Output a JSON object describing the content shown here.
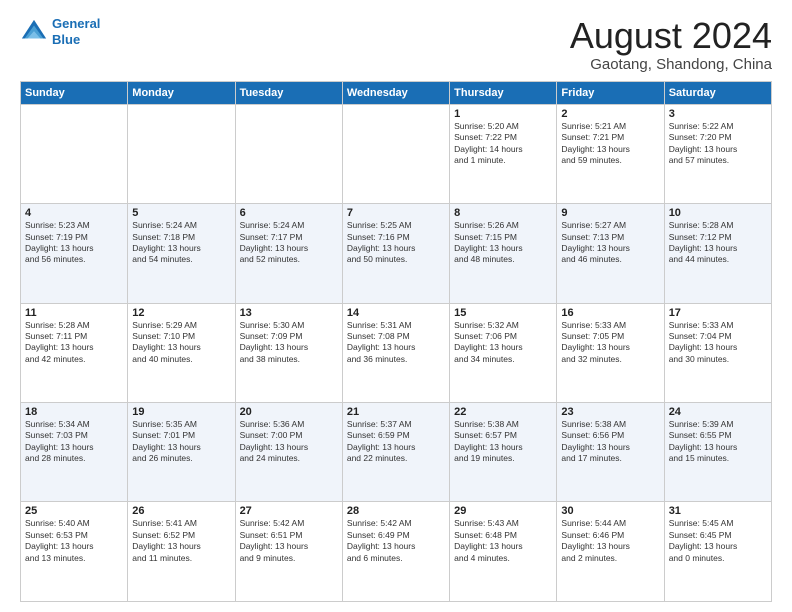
{
  "logo": {
    "line1": "General",
    "line2": "Blue"
  },
  "title": "August 2024",
  "location": "Gaotang, Shandong, China",
  "days_header": [
    "Sunday",
    "Monday",
    "Tuesday",
    "Wednesday",
    "Thursday",
    "Friday",
    "Saturday"
  ],
  "weeks": [
    [
      {
        "num": "",
        "info": ""
      },
      {
        "num": "",
        "info": ""
      },
      {
        "num": "",
        "info": ""
      },
      {
        "num": "",
        "info": ""
      },
      {
        "num": "1",
        "info": "Sunrise: 5:20 AM\nSunset: 7:22 PM\nDaylight: 14 hours\nand 1 minute."
      },
      {
        "num": "2",
        "info": "Sunrise: 5:21 AM\nSunset: 7:21 PM\nDaylight: 13 hours\nand 59 minutes."
      },
      {
        "num": "3",
        "info": "Sunrise: 5:22 AM\nSunset: 7:20 PM\nDaylight: 13 hours\nand 57 minutes."
      }
    ],
    [
      {
        "num": "4",
        "info": "Sunrise: 5:23 AM\nSunset: 7:19 PM\nDaylight: 13 hours\nand 56 minutes."
      },
      {
        "num": "5",
        "info": "Sunrise: 5:24 AM\nSunset: 7:18 PM\nDaylight: 13 hours\nand 54 minutes."
      },
      {
        "num": "6",
        "info": "Sunrise: 5:24 AM\nSunset: 7:17 PM\nDaylight: 13 hours\nand 52 minutes."
      },
      {
        "num": "7",
        "info": "Sunrise: 5:25 AM\nSunset: 7:16 PM\nDaylight: 13 hours\nand 50 minutes."
      },
      {
        "num": "8",
        "info": "Sunrise: 5:26 AM\nSunset: 7:15 PM\nDaylight: 13 hours\nand 48 minutes."
      },
      {
        "num": "9",
        "info": "Sunrise: 5:27 AM\nSunset: 7:13 PM\nDaylight: 13 hours\nand 46 minutes."
      },
      {
        "num": "10",
        "info": "Sunrise: 5:28 AM\nSunset: 7:12 PM\nDaylight: 13 hours\nand 44 minutes."
      }
    ],
    [
      {
        "num": "11",
        "info": "Sunrise: 5:28 AM\nSunset: 7:11 PM\nDaylight: 13 hours\nand 42 minutes."
      },
      {
        "num": "12",
        "info": "Sunrise: 5:29 AM\nSunset: 7:10 PM\nDaylight: 13 hours\nand 40 minutes."
      },
      {
        "num": "13",
        "info": "Sunrise: 5:30 AM\nSunset: 7:09 PM\nDaylight: 13 hours\nand 38 minutes."
      },
      {
        "num": "14",
        "info": "Sunrise: 5:31 AM\nSunset: 7:08 PM\nDaylight: 13 hours\nand 36 minutes."
      },
      {
        "num": "15",
        "info": "Sunrise: 5:32 AM\nSunset: 7:06 PM\nDaylight: 13 hours\nand 34 minutes."
      },
      {
        "num": "16",
        "info": "Sunrise: 5:33 AM\nSunset: 7:05 PM\nDaylight: 13 hours\nand 32 minutes."
      },
      {
        "num": "17",
        "info": "Sunrise: 5:33 AM\nSunset: 7:04 PM\nDaylight: 13 hours\nand 30 minutes."
      }
    ],
    [
      {
        "num": "18",
        "info": "Sunrise: 5:34 AM\nSunset: 7:03 PM\nDaylight: 13 hours\nand 28 minutes."
      },
      {
        "num": "19",
        "info": "Sunrise: 5:35 AM\nSunset: 7:01 PM\nDaylight: 13 hours\nand 26 minutes."
      },
      {
        "num": "20",
        "info": "Sunrise: 5:36 AM\nSunset: 7:00 PM\nDaylight: 13 hours\nand 24 minutes."
      },
      {
        "num": "21",
        "info": "Sunrise: 5:37 AM\nSunset: 6:59 PM\nDaylight: 13 hours\nand 22 minutes."
      },
      {
        "num": "22",
        "info": "Sunrise: 5:38 AM\nSunset: 6:57 PM\nDaylight: 13 hours\nand 19 minutes."
      },
      {
        "num": "23",
        "info": "Sunrise: 5:38 AM\nSunset: 6:56 PM\nDaylight: 13 hours\nand 17 minutes."
      },
      {
        "num": "24",
        "info": "Sunrise: 5:39 AM\nSunset: 6:55 PM\nDaylight: 13 hours\nand 15 minutes."
      }
    ],
    [
      {
        "num": "25",
        "info": "Sunrise: 5:40 AM\nSunset: 6:53 PM\nDaylight: 13 hours\nand 13 minutes."
      },
      {
        "num": "26",
        "info": "Sunrise: 5:41 AM\nSunset: 6:52 PM\nDaylight: 13 hours\nand 11 minutes."
      },
      {
        "num": "27",
        "info": "Sunrise: 5:42 AM\nSunset: 6:51 PM\nDaylight: 13 hours\nand 9 minutes."
      },
      {
        "num": "28",
        "info": "Sunrise: 5:42 AM\nSunset: 6:49 PM\nDaylight: 13 hours\nand 6 minutes."
      },
      {
        "num": "29",
        "info": "Sunrise: 5:43 AM\nSunset: 6:48 PM\nDaylight: 13 hours\nand 4 minutes."
      },
      {
        "num": "30",
        "info": "Sunrise: 5:44 AM\nSunset: 6:46 PM\nDaylight: 13 hours\nand 2 minutes."
      },
      {
        "num": "31",
        "info": "Sunrise: 5:45 AM\nSunset: 6:45 PM\nDaylight: 13 hours\nand 0 minutes."
      }
    ]
  ]
}
